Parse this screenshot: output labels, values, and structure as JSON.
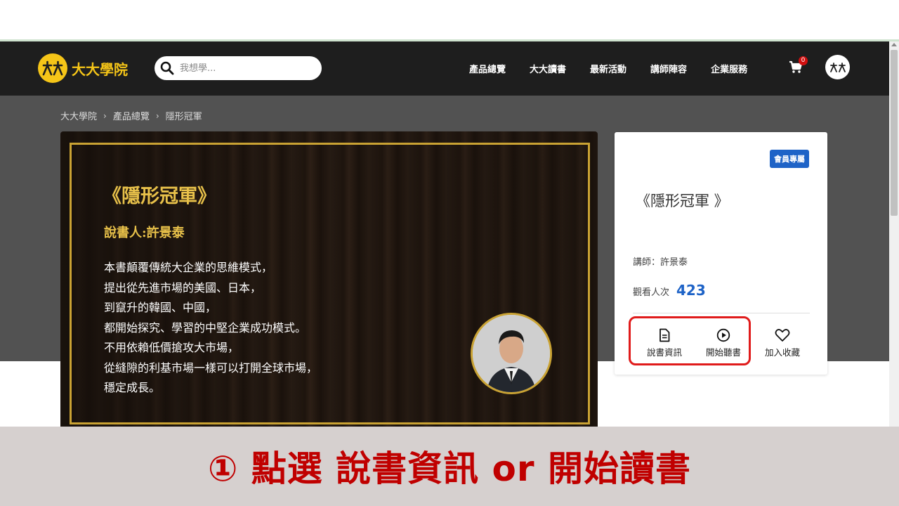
{
  "header": {
    "logo_text": "大大學院",
    "search_placeholder": "我想學...",
    "nav": [
      "產品總覽",
      "大大讀書",
      "最新活動",
      "講師陣容",
      "企業服務"
    ],
    "cart_count": "0"
  },
  "breadcrumb": [
    "大大學院",
    "產品總覽",
    "隱形冠軍"
  ],
  "hero": {
    "title": "《隱形冠軍》",
    "author": "說書人:許景泰",
    "description": [
      "本書顛覆傳統大企業的思維模式，",
      "提出從先進市場的美國、日本，",
      "到竄升的韓國、中國，",
      "都開始探究、學習的中堅企業成功模式。",
      "不用依賴低價搶攻大市場，",
      "從縫隙的利基市場一樣可以打開全球市場，",
      "穩定成長。"
    ]
  },
  "card": {
    "badge": "會員專屬",
    "title": "《隱形冠軍 》",
    "instructor": "講師：許景泰",
    "views_label": "觀看人次",
    "views_value": "423",
    "actions": [
      "說書資訊",
      "開始聽書",
      "加入收藏"
    ]
  },
  "banner": {
    "text": "① 點選 說書資訊 or 開始讀書"
  },
  "colors": {
    "brand_yellow": "#f5c518",
    "accent_blue": "#1e63c7",
    "highlight_red": "#e01b1b"
  }
}
